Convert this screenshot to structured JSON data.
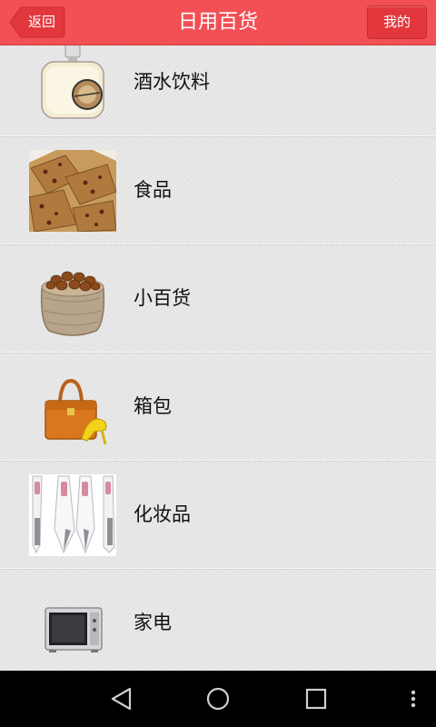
{
  "header": {
    "title": "日用百货",
    "back_label": "返回",
    "my_label": "我的"
  },
  "categories": [
    {
      "label": "酒水饮料",
      "icon": "perfume-bottle-icon"
    },
    {
      "label": "食品",
      "icon": "cookies-image"
    },
    {
      "label": "小百货",
      "icon": "nuts-sack-image"
    },
    {
      "label": "箱包",
      "icon": "handbag-shoe-image"
    },
    {
      "label": "化妆品",
      "icon": "beauty-device-image"
    },
    {
      "label": "家电",
      "icon": "microwave-image"
    }
  ],
  "navbar": {
    "items": [
      "back-icon",
      "home-icon",
      "recents-icon",
      "overflow-menu-icon"
    ]
  },
  "colors": {
    "header_bg": "#f25055",
    "button_bg": "#e2373d",
    "list_bg": "#e7e7e7",
    "navbar_bg": "#000000"
  }
}
